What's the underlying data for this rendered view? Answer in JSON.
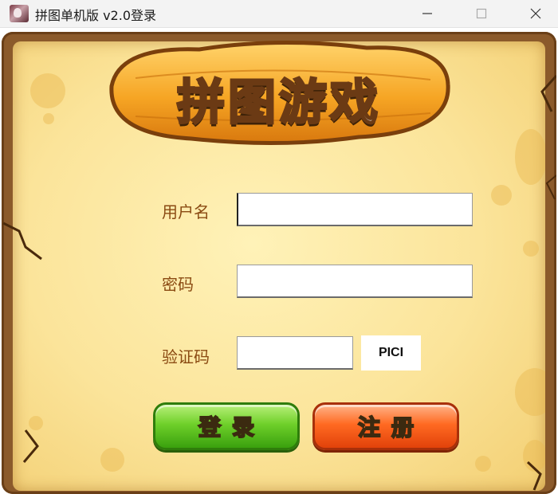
{
  "window": {
    "title": "拼图单机版 v2.0登录",
    "icon": "avatar-icon",
    "controls": [
      "minimize-icon",
      "maximize-icon",
      "close-icon"
    ]
  },
  "banner": {
    "title": "拼图游戏"
  },
  "form": {
    "username_label": "用户名",
    "username_value": "",
    "password_label": "密码",
    "password_value": "",
    "captcha_label": "验证码",
    "captcha_value": "",
    "captcha_code": "PICI"
  },
  "buttons": {
    "login": "登录",
    "register": "注册"
  },
  "colors": {
    "parchment": "#fbe49a",
    "frame": "#8b5a2b",
    "label": "#8a4a12",
    "login": "#6fd02a",
    "register": "#ff6a22"
  }
}
